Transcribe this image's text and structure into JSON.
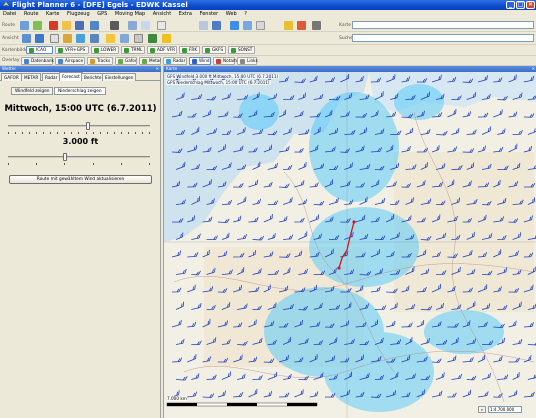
{
  "window": {
    "title": "Flight Planner 6 - [DFE] Egels - EDWK Kassel"
  },
  "menu": [
    "Datei",
    "Route",
    "Karte",
    "Flugzeug",
    "GPS",
    "Moving Map",
    "Ansicht",
    "Extra",
    "Fenster",
    "Web",
    "?"
  ],
  "toolbar": {
    "route_label": "Route",
    "ansicht_label": "Ansicht",
    "search_label": "Karte",
    "search2_label": "Suche"
  },
  "layers": {
    "kartenbilder_label": "Kartenbilder",
    "overlay_label": "Overlay",
    "chart_buttons": [
      "ICAO",
      "VFR+GPS",
      "LOWER",
      "TRML",
      "ADF VFR",
      "FRK",
      "GKFS",
      "SONST"
    ],
    "overlay_buttons": [
      "Datenbank",
      "Airspace",
      "Tracks",
      "Gafor",
      "Metar",
      "Radar",
      "Wind",
      "Notam",
      "Links"
    ]
  },
  "left_panel": {
    "title": "Wetter",
    "tabs": [
      "GAFOR",
      "METAR",
      "Radar",
      "Forecast",
      "Berichte",
      "Einstellungen"
    ],
    "active_tab": 3,
    "subtabs": [
      "Windfeld zeigen",
      "Niederschlag zeigen"
    ],
    "active_subtab": 1,
    "datetime": "Mittwoch, 15:00 UTC (6.7.2011)",
    "time_slider": 0.56,
    "altitude": "3.000 ft",
    "altitude_slider": 0.4,
    "apply_button": "Route mit gewähltem Wind aktualisieren"
  },
  "map_panel": {
    "title": "Karte",
    "legend_wind": "GFS Windfeld 3.000 ft Mittwoch, 15:00 UTC (6.7.2011)",
    "legend_precip": "GFS Niederschlag Mittwoch, 15:00 UTC (6.7.2011)",
    "scale_text": "7.000 km",
    "scale_value": "1:4.700.000"
  },
  "colors": {
    "wind_barb": "#1f3fbf",
    "route": "#d81818",
    "precipitation": "#3fc6ff",
    "titlebar": "#0a4bd0"
  }
}
